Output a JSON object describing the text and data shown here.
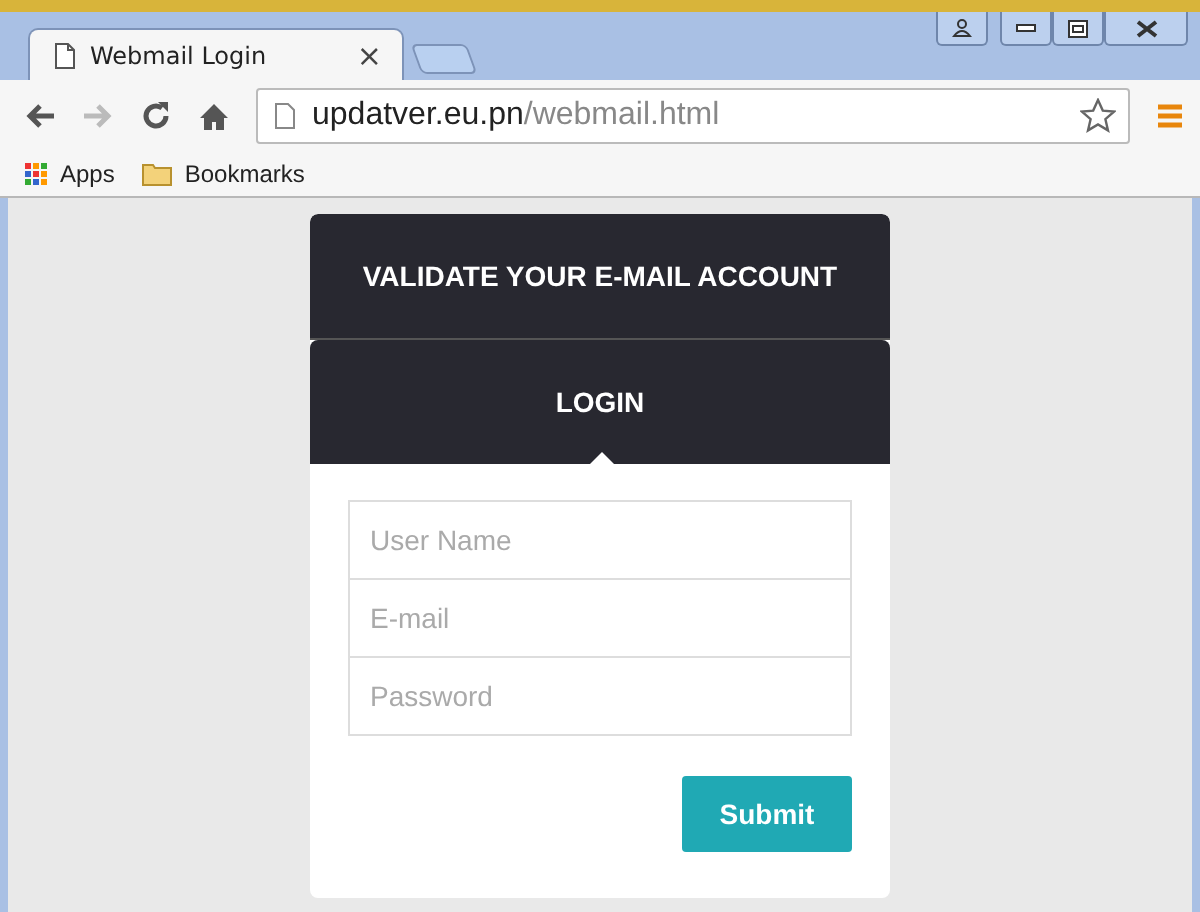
{
  "tab": {
    "title": "Webmail Login",
    "close": "×"
  },
  "address_bar": {
    "host": "updatver.eu.pn",
    "path": "/webmail.html"
  },
  "bookmarks": [
    "Apps",
    "Bookmarks"
  ],
  "card": {
    "title": "VALIDATE YOUR E-MAIL ACCOUNT",
    "section": "LOGIN",
    "fields": [
      {
        "placeholder": "User Name"
      },
      {
        "placeholder": "E-mail"
      },
      {
        "placeholder": "Password"
      }
    ],
    "submit": "Submit"
  }
}
